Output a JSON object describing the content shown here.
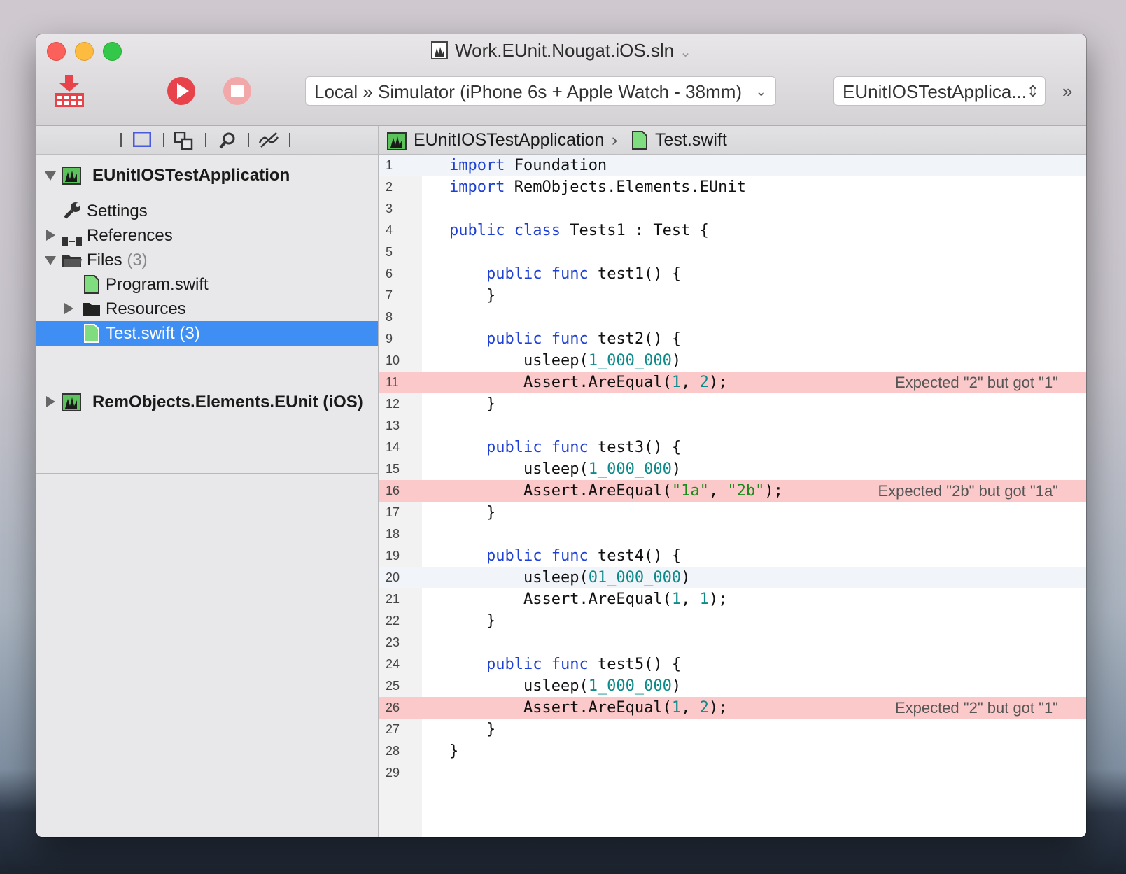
{
  "window": {
    "title": "Work.EUnit.Nougat.iOS.sln",
    "title_chevron": "⌄"
  },
  "toolbar": {
    "build_icon": "build-icon",
    "run_icon": "run-icon",
    "stop_icon": "stop-icon",
    "scheme": "Local » Simulator (iPhone 6s + Apple Watch - 38mm)",
    "target": "EUnitIOSTestApplica...",
    "overflow": "»"
  },
  "sidebar": {
    "toolbar_icons": [
      "project-icon",
      "files-icon",
      "search-icon",
      "issues-icon"
    ],
    "tree": {
      "project": "EUnitIOSTestApplication",
      "settings": "Settings",
      "references": "References",
      "files": "Files",
      "files_count": "(3)",
      "program": "Program.swift",
      "resources": "Resources",
      "test": "Test.swift (3)",
      "project2": "RemObjects.Elements.EUnit (iOS)"
    }
  },
  "editor": {
    "jumpbar": {
      "project": "EUnitIOSTestApplication",
      "separator": "›",
      "file": "Test.swift"
    },
    "messages": {
      "line11": "Expected \"2\" but got \"1\"",
      "line16": "Expected \"2b\" but got \"1a\"",
      "line26": "Expected \"2\" but got \"1\""
    },
    "line_numbers": [
      "1",
      "2",
      "3",
      "4",
      "5",
      "6",
      "7",
      "8",
      "9",
      "10",
      "11",
      "12",
      "13",
      "14",
      "15",
      "16",
      "17",
      "18",
      "19",
      "20",
      "21",
      "22",
      "23",
      "24",
      "25",
      "26",
      "27",
      "28",
      "29"
    ],
    "code": {
      "kw_import": "import",
      "foundation": " Foundation",
      "remobjects": " RemObjects.Elements.EUnit",
      "kw_public": "public",
      "kw_class": "class",
      "kw_func": "func",
      "tests1": " Tests1 : Test {",
      "test1": " test1() {",
      "test2": " test2() {",
      "test3": " test3() {",
      "test4": " test4() {",
      "test5": " test5() {",
      "brace_close": "}",
      "usleep_open": "usleep(",
      "usleep_close": ")",
      "num_1_000_000": "1_000_000",
      "num_01_000_000": "01_000_000",
      "assert_open": "Assert.AreEqual(",
      "comma": ", ",
      "close_semi": ");",
      "n1": "1",
      "n2": "2",
      "s1a": "\"1a\"",
      "s2b": "\"2b\""
    }
  }
}
